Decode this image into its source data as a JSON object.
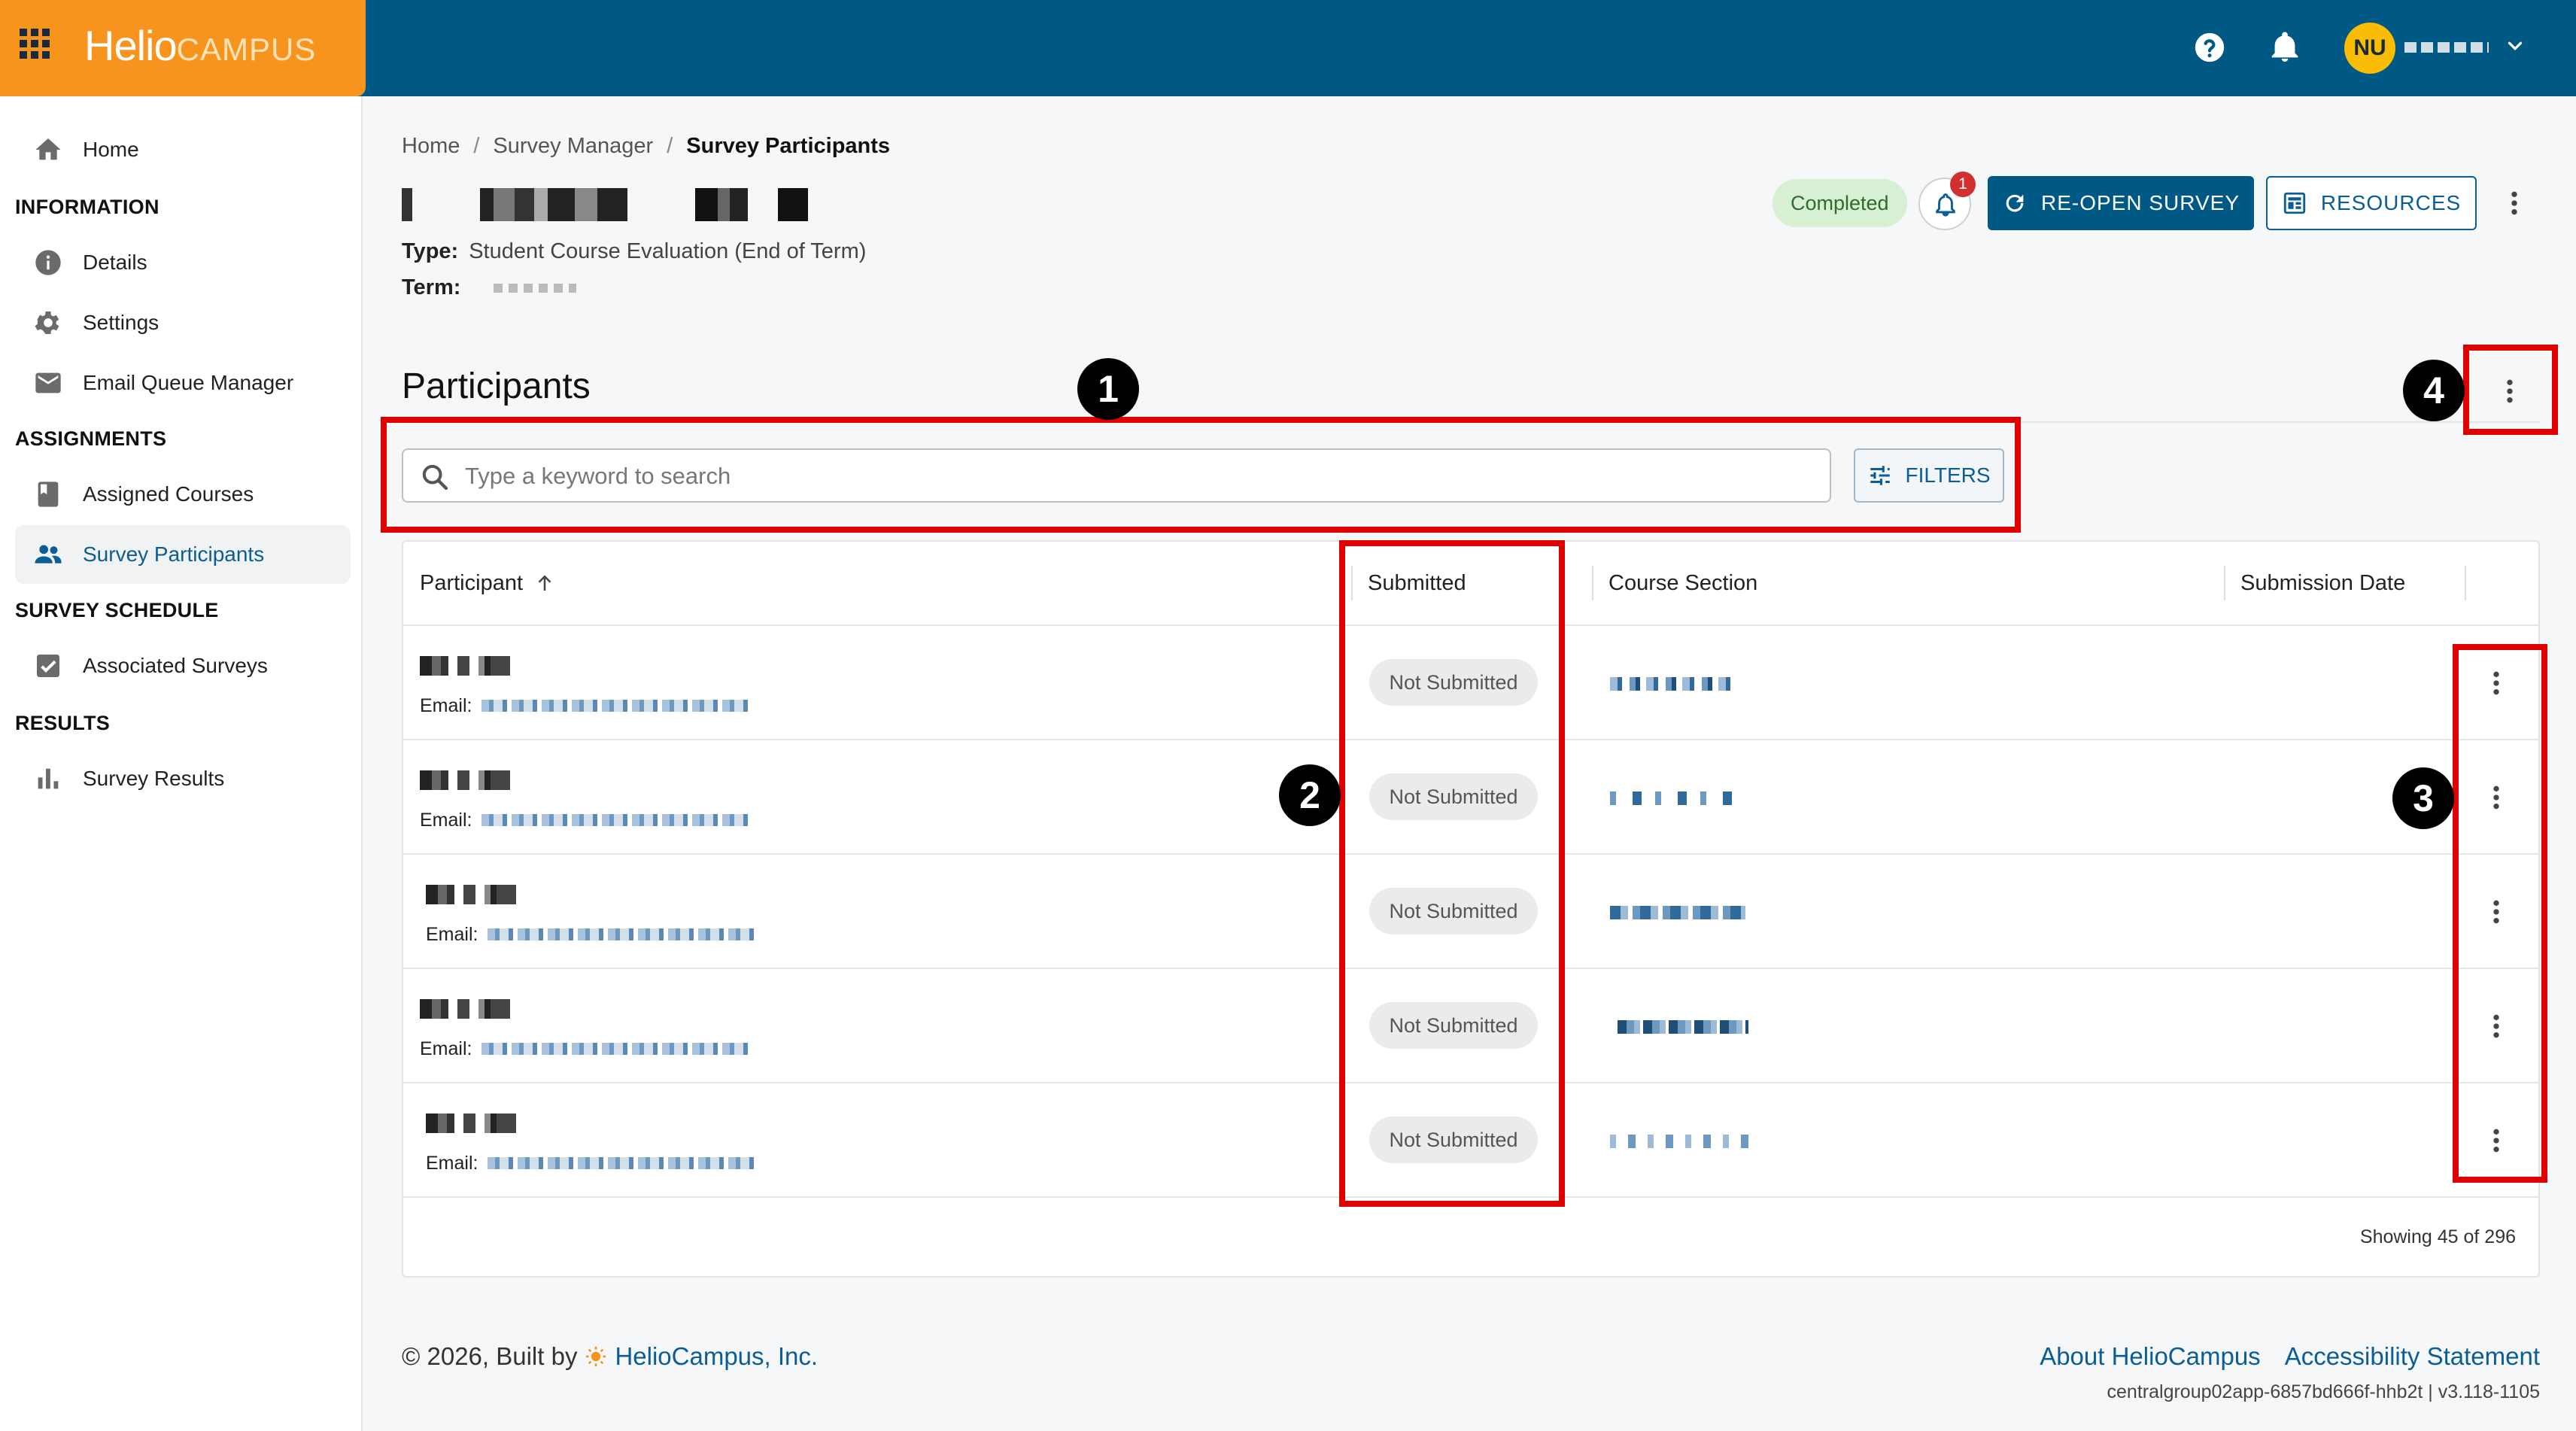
{
  "app": {
    "brand_main": "Helio",
    "brand_sub": "CAMPUS",
    "user_initials": "NU"
  },
  "colors": {
    "topbar": "#005984",
    "brand": "#f7941d",
    "accent": "#0b5d95",
    "annotation": "#e00000",
    "completed_bg": "#d7f0d3"
  },
  "sidebar": {
    "home": "Home",
    "sections": [
      {
        "title": "INFORMATION",
        "items": [
          "Details",
          "Settings",
          "Email Queue Manager"
        ]
      },
      {
        "title": "ASSIGNMENTS",
        "items": [
          "Assigned Courses",
          "Survey Participants"
        ]
      },
      {
        "title": "SURVEY SCHEDULE",
        "items": [
          "Associated Surveys"
        ]
      },
      {
        "title": "RESULTS",
        "items": [
          "Survey Results"
        ]
      }
    ],
    "active_item": "Survey Participants"
  },
  "breadcrumb": {
    "items": [
      "Home",
      "Survey Manager",
      "Survey Participants"
    ],
    "separator": "/"
  },
  "survey": {
    "type_label": "Type:",
    "type_value": "Student Course Evaluation (End of Term)",
    "term_label": "Term:",
    "status": "Completed",
    "notification_count": "1",
    "reopen_label": "RE-OPEN SURVEY",
    "resources_label": "RESOURCES"
  },
  "participants": {
    "title": "Participants",
    "search_placeholder": "Type a keyword to search",
    "filters_label": "FILTERS",
    "columns": [
      "Participant",
      "Submitted",
      "Course Section",
      "Submission Date"
    ],
    "email_label": "Email:",
    "rows": [
      {
        "submitted": "Not Submitted"
      },
      {
        "submitted": "Not Submitted"
      },
      {
        "submitted": "Not Submitted"
      },
      {
        "submitted": "Not Submitted"
      },
      {
        "submitted": "Not Submitted"
      }
    ],
    "showing": "Showing 45 of 296"
  },
  "annotations": [
    "1",
    "2",
    "3",
    "4"
  ],
  "footer": {
    "copyright": "© 2026, Built by",
    "company": "HelioCampus, Inc.",
    "links": [
      "About HelioCampus",
      "Accessibility Statement"
    ],
    "build": "centralgroup02app-6857bd666f-hhb2t | v3.118-1105"
  },
  "icons": [
    "apps-grid-icon",
    "help-icon",
    "bell-icon",
    "chevron-down-icon",
    "home-icon",
    "info-icon",
    "gear-icon",
    "mail-icon",
    "book-icon",
    "people-icon",
    "checkbox-icon",
    "bar-chart-icon",
    "refresh-icon",
    "resources-icon",
    "kebab-icon",
    "search-icon",
    "filter-icon",
    "arrow-up-icon",
    "sun-icon"
  ]
}
